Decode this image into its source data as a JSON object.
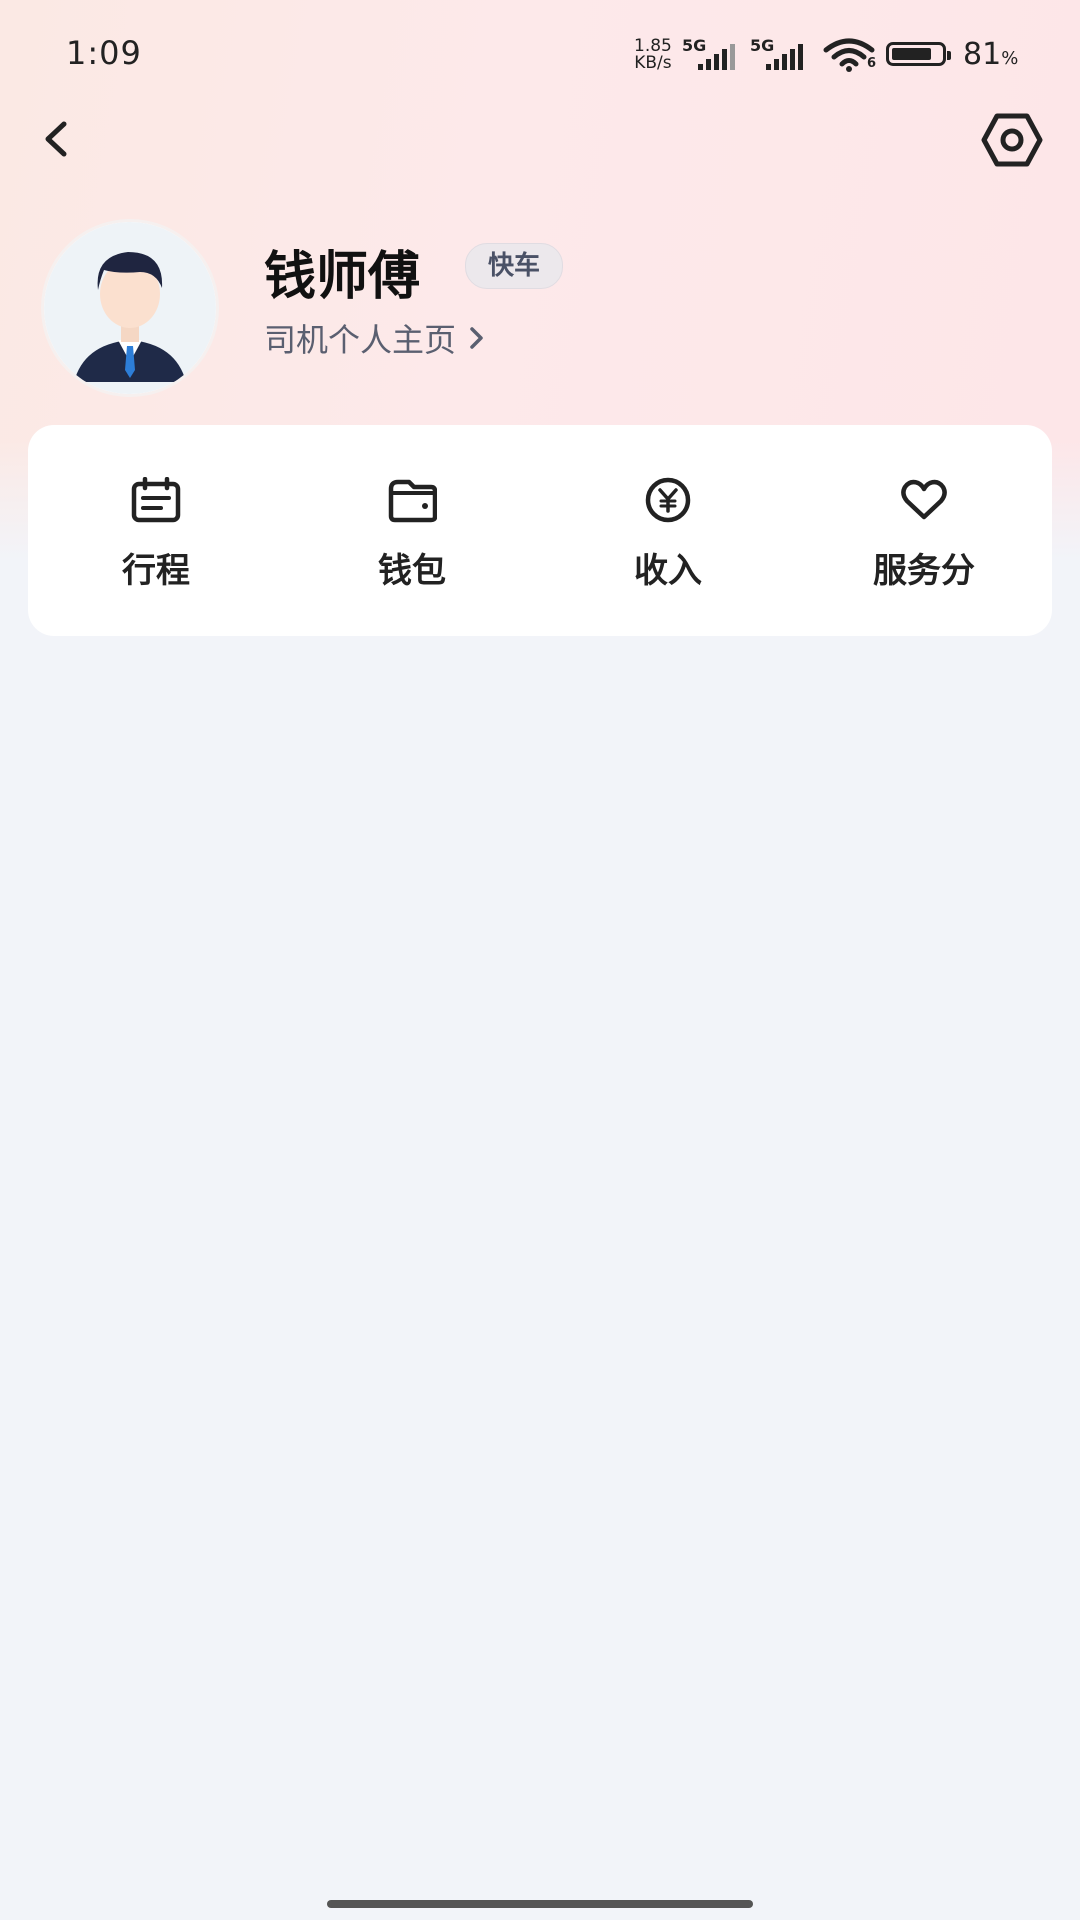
{
  "status_bar": {
    "time": "1:09",
    "net_speed_value": "1.85",
    "net_speed_unit": "KB/s",
    "sim1": "5G",
    "sim2": "5G",
    "wifi_sub": "6",
    "battery": "81",
    "battery_unit": "%",
    "battery_level": 0.81
  },
  "header": {
    "back_icon": "chevron-left-icon",
    "settings_icon": "hex-settings-icon"
  },
  "profile": {
    "name": "钱师傅",
    "badge": "快车",
    "link_label": "司机个人主页"
  },
  "quick_actions": [
    {
      "label": "行程",
      "icon": "calendar-icon"
    },
    {
      "label": "钱包",
      "icon": "wallet-icon"
    },
    {
      "label": "收入",
      "icon": "yen-coin-icon"
    },
    {
      "label": "服务分",
      "icon": "heart-icon"
    }
  ],
  "colors": {
    "accent_text": "#222222",
    "badge_bg": "#ece8ec",
    "header_gradient": "#fde9ea",
    "page_bg": "#f2f4f9"
  }
}
